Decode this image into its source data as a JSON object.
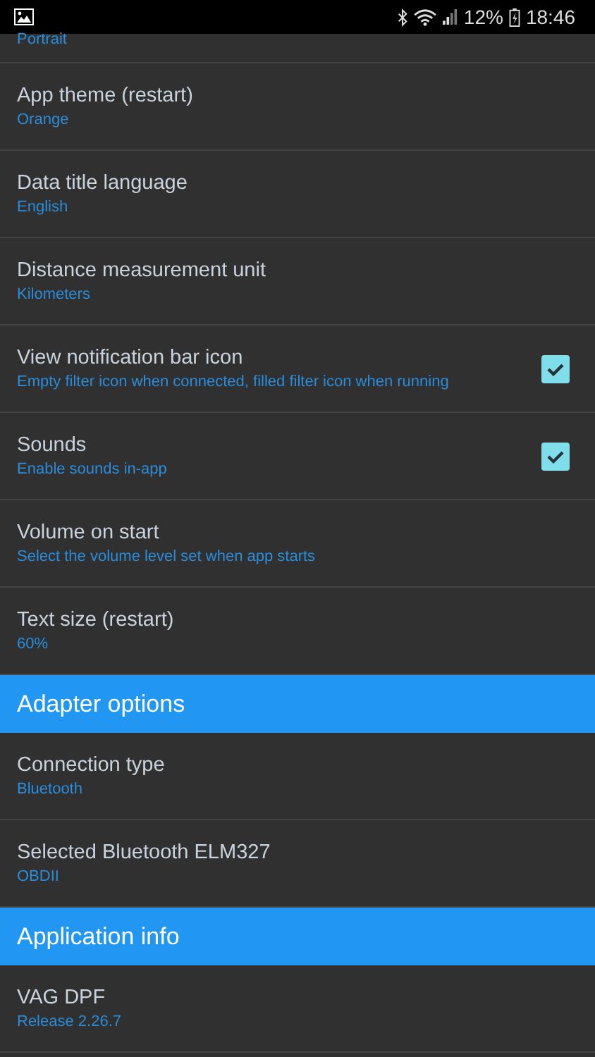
{
  "status_bar": {
    "battery": "12%",
    "time": "18:46"
  },
  "items": [
    {
      "kind": "cut",
      "summary": "Portrait"
    },
    {
      "kind": "pref",
      "title": "App theme (restart)",
      "summary": "Orange"
    },
    {
      "kind": "pref",
      "title": "Data title language",
      "summary": "English"
    },
    {
      "kind": "pref",
      "title": "Distance measurement unit",
      "summary": "Kilometers"
    },
    {
      "kind": "check",
      "title": "View notification bar icon",
      "summary": "Empty filter icon when connected, filled filter icon when running",
      "checked": true
    },
    {
      "kind": "check",
      "title": "Sounds",
      "summary": "Enable sounds in-app",
      "checked": true
    },
    {
      "kind": "pref",
      "title": "Volume on start",
      "summary": "Select the volume level set when app starts"
    },
    {
      "kind": "pref",
      "title": "Text size (restart)",
      "summary": "60%"
    },
    {
      "kind": "header",
      "title": "Adapter options"
    },
    {
      "kind": "pref",
      "title": "Connection type",
      "summary": "Bluetooth"
    },
    {
      "kind": "pref",
      "title": "Selected Bluetooth ELM327",
      "summary": "OBDII"
    },
    {
      "kind": "header",
      "title": "Application info"
    },
    {
      "kind": "pref",
      "title": "VAG DPF",
      "summary": "Release 2.26.7"
    }
  ]
}
